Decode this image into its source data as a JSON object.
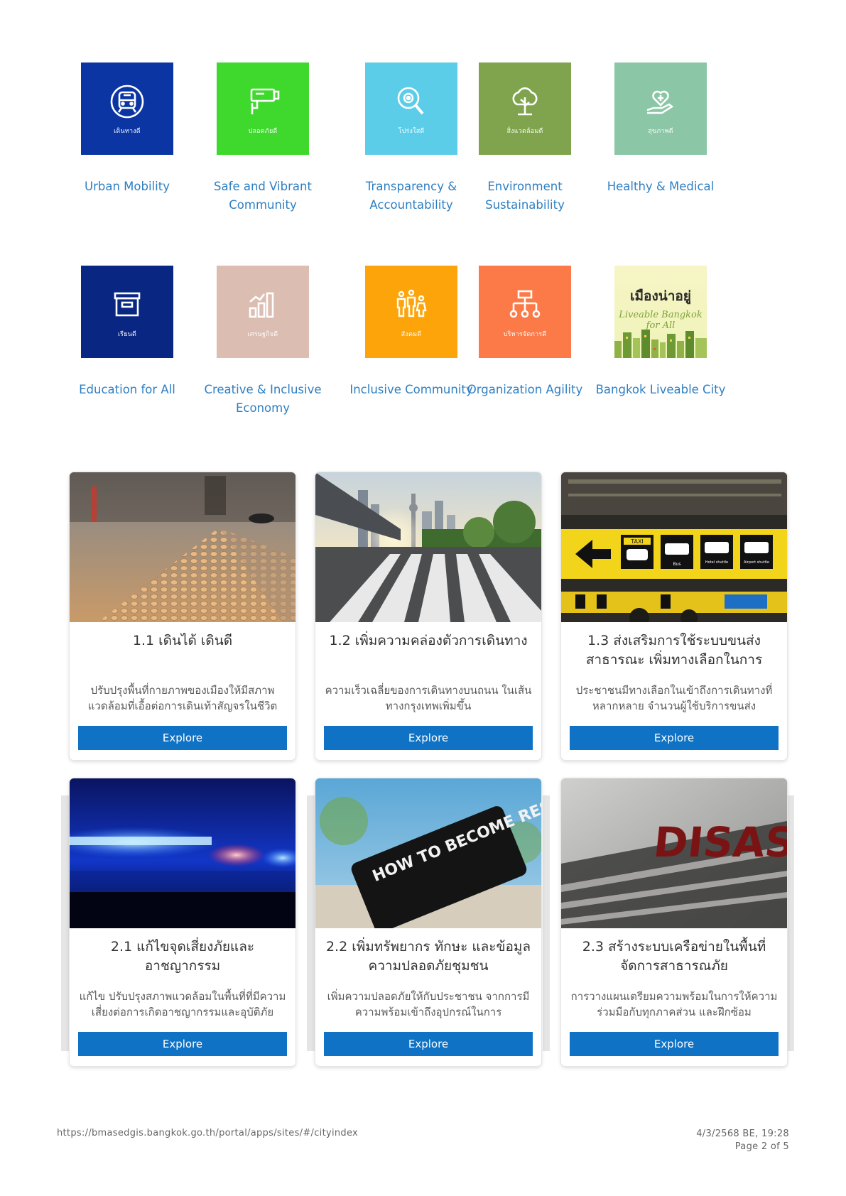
{
  "categories": [
    {
      "label": "Urban Mobility",
      "sub": "เดินทางดี",
      "color": "#0a35a3",
      "icon": "train-icon"
    },
    {
      "label": "Safe and Vibrant Community",
      "sub": "ปลอดภัยดี",
      "color": "#3fd92e",
      "icon": "cctv-icon"
    },
    {
      "label": "Transparency & Accountability",
      "sub": "โปร่งใสดี",
      "color": "#5ccde8",
      "icon": "magnifier-icon"
    },
    {
      "label": "Environment Sustainability",
      "sub": "สิ่งแวดล้อมดี",
      "color": "#80a44d",
      "icon": "tree-icon"
    },
    {
      "label": "Healthy & Medical",
      "sub": "สุขภาพดี",
      "color": "#8bc6a6",
      "icon": "heart-hand-icon"
    },
    {
      "label": "Education for All",
      "sub": "เรียนดี",
      "color": "#0a2683",
      "icon": "box-icon"
    },
    {
      "label": "Creative & Inclusive Economy",
      "sub": "เศรษฐกิจดี",
      "color": "#dbbdb1",
      "icon": "bar-chart-icon"
    },
    {
      "label": "Inclusive Community",
      "sub": "สังคมดี",
      "color": "#fca40a",
      "icon": "people-icon"
    },
    {
      "label": "Organization Agility",
      "sub": "บริหารจัดการดี",
      "color": "#fc7a48",
      "icon": "org-chart-icon"
    },
    {
      "label": "Bangkok Liveable City",
      "poster_title": "เมืองน่าอยู่",
      "poster_script": "Liveable Bangkok for All",
      "icon": "liveable-city-poster"
    }
  ],
  "cards": [
    {
      "title": "1.1 เดินได้ เดินดี",
      "desc": "ปรับปรุงพื้นที่กายภาพของเมืองให้มีสภาพแวดล้อมที่เอื้อต่อการเดินเท้าสัญจรในชีวิตประจำวัน",
      "button": "Explore",
      "image": "tactile-paving-image"
    },
    {
      "title": "1.2 เพิ่มความคล่องตัวการเดินทาง",
      "desc": "ความเร็วเฉลี่ยของการเดินทางบนถนน ในเส้นทางกรุงเทพเพิ่มขึ้น",
      "button": "Explore",
      "image": "crosswalk-city-image"
    },
    {
      "title": "1.3 ส่งเสริมการใช้ระบบขนส่งสาธารณะ เพิ่มทางเลือกในการ",
      "desc": "ประชาชนมีทางเลือกในเข้าถึงการเดินทางที่หลากหลาย จำนวนผู้ใช้บริการขนส่ง",
      "button": "Explore",
      "image": "transport-signs-image",
      "sign_taxi": "TAXI",
      "sign_bus": "Bus",
      "sign_hotel": "Hotel shuttle",
      "sign_airport": "Airport shuttle"
    },
    {
      "title": "2.1 แก้ไขจุดเสี่ยงภัยและอาชญากรรม",
      "desc": "แก้ไข ปรับปรุงสภาพแวดล้อมในพื้นที่ที่มีความเสี่ยงต่อการเกิดอาชญากรรมและอุบัติภัย",
      "button": "Explore",
      "image": "police-lights-image"
    },
    {
      "title": "2.2 เพิ่มทรัพยากร ทักษะ และข้อมูลความปลอดภัยชุมชน",
      "desc": "เพิ่มความปลอดภัยให้กับประชาชน จากการมีความพร้อมเข้าถึงอุปกรณ์ในการ",
      "button": "Explore",
      "image": "resilient-sign-image",
      "sign_text": "HOW TO BECOME RESILIENT ?"
    },
    {
      "title": "2.3 สร้างระบบเครือข่ายในพื้นที่จัดการสาธารณภัย",
      "desc": "การวางแผนเตรียมความพร้อมในการให้ความร่วมมือกับทุกภาคส่วน และฝึกซ้อม",
      "button": "Explore",
      "image": "disaster-text-image",
      "sign_text": "DISASTER"
    }
  ],
  "footer": {
    "url": "https://bmasedgis.bangkok.go.th/portal/apps/sites/#/cityindex",
    "datetime": "4/3/2568 BE, 19:28",
    "page": "Page 2 of 5"
  }
}
